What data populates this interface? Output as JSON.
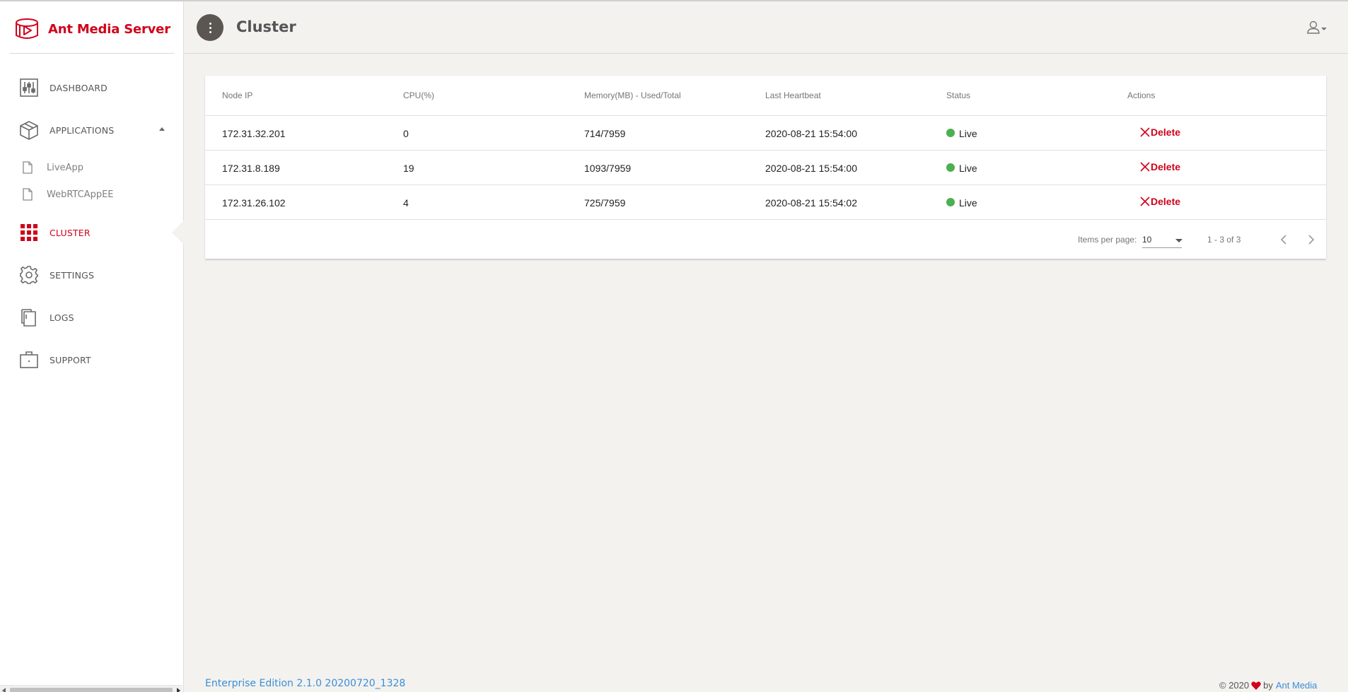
{
  "brand": {
    "name": "Ant Media Server"
  },
  "sidebar": {
    "items": [
      {
        "label": "DASHBOARD",
        "icon": "dashboard-sliders-icon"
      },
      {
        "label": "APPLICATIONS",
        "icon": "box-icon",
        "expanded": true
      },
      {
        "label": "CLUSTER",
        "icon": "grid-icon",
        "active": true
      },
      {
        "label": "SETTINGS",
        "icon": "gear-icon"
      },
      {
        "label": "LOGS",
        "icon": "documents-icon"
      },
      {
        "label": "SUPPORT",
        "icon": "briefcase-icon"
      }
    ],
    "apps": [
      {
        "label": "LiveApp",
        "icon": "file-icon"
      },
      {
        "label": "WebRTCAppEE",
        "icon": "file-icon"
      }
    ]
  },
  "header": {
    "title": "Cluster",
    "menu_icon": "more-vert-icon",
    "user_icon": "user-dropdown-icon"
  },
  "table": {
    "columns": [
      "Node IP",
      "CPU(%)",
      "Memory(MB) - Used/Total",
      "Last Heartbeat",
      "Status",
      "Actions"
    ],
    "rows": [
      {
        "ip": "172.31.32.201",
        "cpu": "0",
        "memory": "714/7959",
        "heartbeat": "2020-08-21 15:54:00",
        "status": "Live",
        "action": "Delete"
      },
      {
        "ip": "172.31.8.189",
        "cpu": "19",
        "memory": "1093/7959",
        "heartbeat": "2020-08-21 15:54:00",
        "status": "Live",
        "action": "Delete"
      },
      {
        "ip": "172.31.26.102",
        "cpu": "4",
        "memory": "725/7959",
        "heartbeat": "2020-08-21 15:54:02",
        "status": "Live",
        "action": "Delete"
      }
    ]
  },
  "paginator": {
    "items_per_page_label": "Items per page:",
    "items_per_page": "10",
    "range": "1 - 3 of 3"
  },
  "footer": {
    "edition": "Enterprise Edition 2.1.0 20200720_1328",
    "copyright": "© 2020",
    "by": "by",
    "company": "Ant Media"
  },
  "colors": {
    "brand": "#d0021b",
    "live": "#4caf50",
    "link": "#3b8ed6",
    "background": "#f3f2ef"
  }
}
